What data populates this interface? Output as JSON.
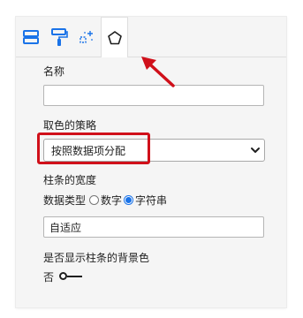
{
  "tabs": [
    {
      "id": "fields",
      "icon": "fields-icon",
      "active": false
    },
    {
      "id": "format",
      "icon": "paint-roller-icon",
      "active": false
    },
    {
      "id": "analytics",
      "icon": "magic-icon",
      "active": false
    },
    {
      "id": "general",
      "icon": "pentagon-icon",
      "active": true
    }
  ],
  "form": {
    "name_label": "名称",
    "name_value": "",
    "color_strategy_label": "取色的策略",
    "color_strategy_value": "按照数据项分配",
    "bar_width_label": "柱条的宽度",
    "data_type_label": "数据类型",
    "data_type_options": [
      {
        "label": "数字",
        "checked": false
      },
      {
        "label": "字符串",
        "checked": true
      }
    ],
    "bar_width_value": "自适应",
    "show_bg_label": "是否显示柱条的背景色",
    "show_bg_state": "否"
  },
  "colors": {
    "highlight": "#d0101a",
    "accent": "#1a73e8",
    "icon_blue": "#1a73e8"
  }
}
